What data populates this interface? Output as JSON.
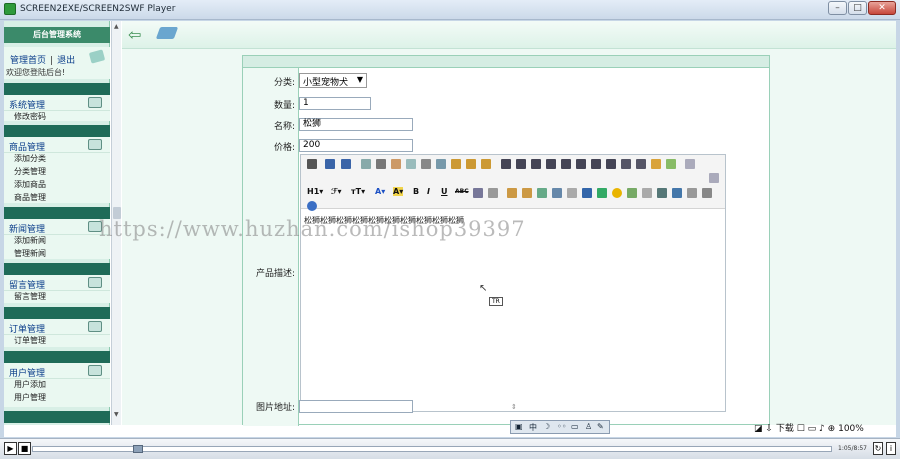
{
  "window": {
    "title": "SCREEN2EXE/SCREEN2SWF Player",
    "min": "–",
    "max": "□",
    "close": "✕"
  },
  "sidebar": {
    "header": "后台管理系统",
    "link_home": "管理首页",
    "sep": "|",
    "link_logout": "退出",
    "welcome": "欢迎您登陆后台!",
    "groups": [
      {
        "title": "系统管理",
        "items": [
          "修改密码"
        ]
      },
      {
        "title": "商品管理",
        "items": [
          "添加分类",
          "分类管理",
          "添加商品",
          "商品管理"
        ]
      },
      {
        "title": "新闻管理",
        "items": [
          "添加新闻",
          "管理新闻"
        ]
      },
      {
        "title": "留言管理",
        "items": [
          "留言管理"
        ]
      },
      {
        "title": "订单管理",
        "items": [
          "订单管理"
        ]
      },
      {
        "title": "用户管理",
        "items": [
          "用户添加",
          "用户管理"
        ]
      }
    ]
  },
  "form": {
    "category_label": "分类:",
    "category_value": "小型宠物犬",
    "qty_label": "数量:",
    "qty_value": "1",
    "name_label": "名称:",
    "name_value": "松狮",
    "price_label": "价格:",
    "price_value": "200",
    "desc_label": "产品描述:",
    "desc_text": "松狮松狮松狮松狮松狮松狮松狮松狮松狮松狮",
    "image_label": "图片地址:"
  },
  "editor": {
    "font_size_btn": "H1▾",
    "font_family_btn": "ℱ▾",
    "text_size_btn": "ᴛT▾",
    "font_color_btn": "A▾",
    "bg_color_btn": "A▾",
    "bold": "B",
    "italic": "I",
    "underline": "U",
    "strike": "ABC",
    "cursor_tag": "TR"
  },
  "watermark": "https://www.huzhan.com/ishop39397",
  "tray": {
    "download": "下载",
    "zoom": "100%"
  },
  "player": {
    "time": "1:05/8:57",
    "play": "▶",
    "stop": "■"
  },
  "ime": {
    "cn": "中",
    "moon": "☽"
  },
  "colors": {
    "accent": "#1f6b58",
    "sidebar_bg": "#eaf8f1",
    "content_bg": "#eef9f4"
  }
}
